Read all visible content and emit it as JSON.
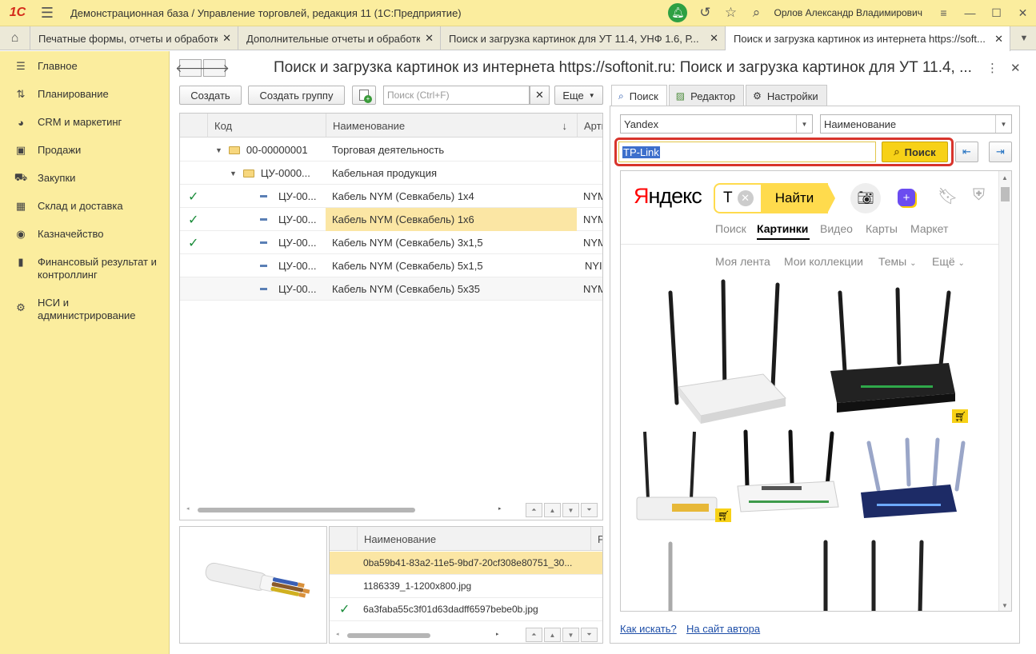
{
  "titlebar": {
    "logo": "1С",
    "title": "Демонстрационная база / Управление торговлей, редакция 11  (1С:Предприятие)",
    "user": "Орлов Александр Владимирович"
  },
  "open_tabs": [
    {
      "label": "Печатные формы, отчеты и обработки"
    },
    {
      "label": "Дополнительные отчеты и обработки"
    },
    {
      "label": "Поиск и загрузка картинок для УТ 11.4, УНФ 1.6, Р..."
    },
    {
      "label": "Поиск и загрузка картинок из интернета https://soft..."
    }
  ],
  "sidebar": {
    "items": [
      {
        "label": "Главное",
        "icon": "menu-lines-icon"
      },
      {
        "label": "Планирование",
        "icon": "planning-icon"
      },
      {
        "label": "CRM и маркетинг",
        "icon": "pie-icon"
      },
      {
        "label": "Продажи",
        "icon": "bag-icon"
      },
      {
        "label": "Закупки",
        "icon": "cart-icon"
      },
      {
        "label": "Склад и доставка",
        "icon": "grid-icon"
      },
      {
        "label": "Казначейство",
        "icon": "coin-icon"
      },
      {
        "label": "Финансовый результат и контроллинг",
        "icon": "bar-chart-icon"
      },
      {
        "label": "НСИ и администрирование",
        "icon": "gear-icon"
      }
    ]
  },
  "form": {
    "title": "Поиск и загрузка картинок из интернета https://softonit.ru: Поиск и загрузка картинок для УТ 11.4, ..."
  },
  "toolbar": {
    "create": "Создать",
    "create_group": "Создать группу",
    "search_placeholder": "Поиск (Ctrl+F)",
    "more": "Еще"
  },
  "grid": {
    "columns": [
      "Код",
      "Наименование",
      "Арти"
    ],
    "sort_indicator": "↓",
    "rows": [
      {
        "checked": false,
        "level": 0,
        "type": "folder",
        "code": "00-00000001",
        "name": "Торговая деятельность",
        "art": ""
      },
      {
        "checked": false,
        "level": 1,
        "type": "folder",
        "code": "ЦУ-0000...",
        "name": "Кабельная продукция",
        "art": ""
      },
      {
        "checked": true,
        "level": 2,
        "type": "item",
        "code": "ЦУ-00...",
        "name": "Кабель NYM (Севкабель) 1х4",
        "art": "NYM"
      },
      {
        "checked": true,
        "level": 2,
        "type": "item",
        "code": "ЦУ-00...",
        "name": "Кабель NYM (Севкабель) 1х6",
        "art": "NYM",
        "selected": true
      },
      {
        "checked": true,
        "level": 2,
        "type": "item",
        "code": "ЦУ-00...",
        "name": "Кабель NYM (Севкабель) 3х1,5",
        "art": "NYM"
      },
      {
        "checked": false,
        "level": 2,
        "type": "item",
        "code": "ЦУ-00...",
        "name": "Кабель NYM (Севкабель) 5х1,5",
        "art": "NYI"
      },
      {
        "checked": false,
        "level": 2,
        "type": "item",
        "code": "ЦУ-00...",
        "name": "Кабель NYM (Севкабель) 5х35",
        "art": "NYM"
      }
    ]
  },
  "files": {
    "column": "Наименование",
    "column2": "Р",
    "rows": [
      {
        "checked": false,
        "name": "0ba59b41-83a2-11e5-9bd7-20cf308e80751_30...",
        "selected": true
      },
      {
        "checked": false,
        "name": "1186339_1-1200x800.jpg"
      },
      {
        "checked": true,
        "name": "6a3faba55c3f01d63dadff6597bebe0b.jpg"
      }
    ]
  },
  "right_tabs": [
    {
      "label": "Поиск",
      "icon": "search-icon"
    },
    {
      "label": "Редактор",
      "icon": "image-icon"
    },
    {
      "label": "Настройки",
      "icon": "gear-icon"
    }
  ],
  "search": {
    "engine": "Yandex",
    "field": "Наименование",
    "query": "TP-Link",
    "button": "Поиск"
  },
  "yandex": {
    "logo": "Яндекс",
    "query_letter": "T",
    "find": "Найти",
    "nav": [
      "Поиск",
      "Картинки",
      "Видео",
      "Карты",
      "Маркет"
    ],
    "subnav": [
      "Моя лента",
      "Мои коллекции",
      "Темы",
      "Ещё"
    ]
  },
  "links": {
    "how": "Как искать?",
    "author": "На сайт автора"
  },
  "colors": {
    "accent_yellow": "#fbed9e",
    "search_button": "#f7d117",
    "highlight_red": "#d8342c",
    "link": "#1f4fa8"
  }
}
